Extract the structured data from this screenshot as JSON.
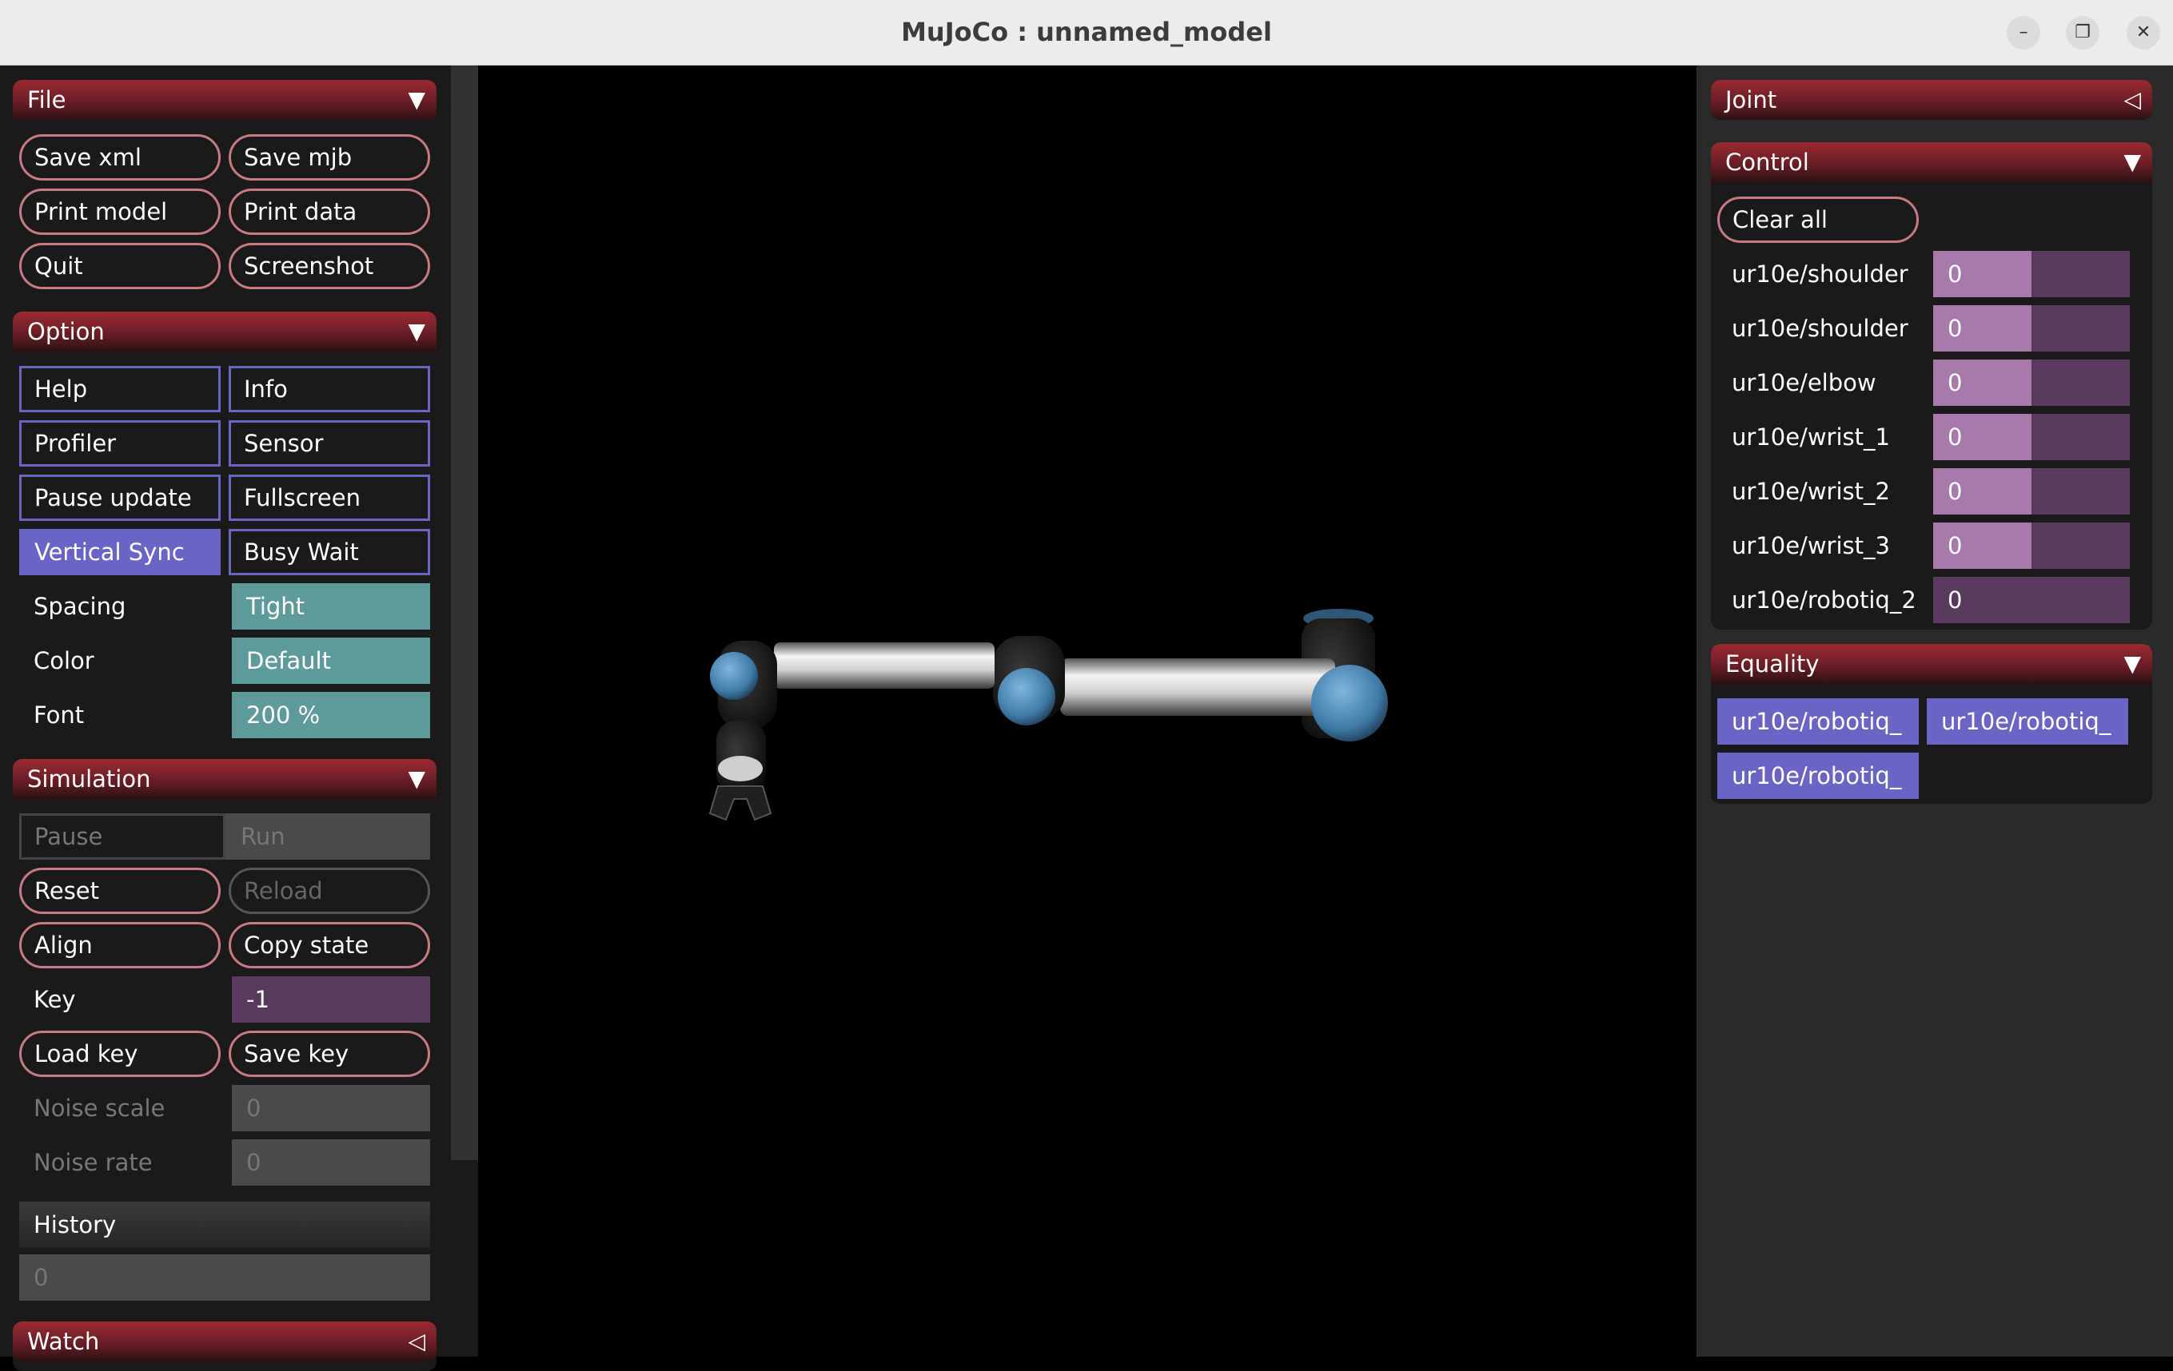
{
  "window": {
    "title": "MuJoCo : unnamed_model",
    "minimize_icon": "minimize-icon",
    "restore_icon": "restore-icon",
    "close_icon": "close-icon"
  },
  "file": {
    "title": "File",
    "buttons": [
      "Save xml",
      "Save mjb",
      "Print model",
      "Print data",
      "Quit",
      "Screenshot"
    ]
  },
  "option": {
    "title": "Option",
    "checks": [
      {
        "label": "Help",
        "checked": false
      },
      {
        "label": "Info",
        "checked": false
      },
      {
        "label": "Profiler",
        "checked": false
      },
      {
        "label": "Sensor",
        "checked": false
      },
      {
        "label": "Pause update",
        "checked": false
      },
      {
        "label": "Fullscreen",
        "checked": false
      },
      {
        "label": "Vertical Sync",
        "checked": true
      },
      {
        "label": "Busy Wait",
        "checked": false
      }
    ],
    "spacing_label": "Spacing",
    "spacing_value": "Tight",
    "color_label": "Color",
    "color_value": "Default",
    "font_label": "Font",
    "font_value": "200 %"
  },
  "simulation": {
    "title": "Simulation",
    "pause": "Pause",
    "run": "Run",
    "reset": "Reset",
    "reload": "Reload",
    "align": "Align",
    "copy_state": "Copy state",
    "key_label": "Key",
    "key_value": "-1",
    "load_key": "Load key",
    "save_key": "Save key",
    "noise_scale_label": "Noise scale",
    "noise_scale_value": "0",
    "noise_rate_label": "Noise rate",
    "noise_rate_value": "0",
    "history_label": "History",
    "history_value": "0"
  },
  "watch": {
    "title": "Watch"
  },
  "joint": {
    "title": "Joint"
  },
  "control": {
    "title": "Control",
    "clear_all": "Clear all",
    "rows": [
      {
        "label": "ur10e/shoulder",
        "value": "0",
        "fill": 0.5
      },
      {
        "label": "ur10e/shoulder",
        "value": "0",
        "fill": 0.5
      },
      {
        "label": "ur10e/elbow",
        "value": "0",
        "fill": 0.5
      },
      {
        "label": "ur10e/wrist_1",
        "value": "0",
        "fill": 0.5
      },
      {
        "label": "ur10e/wrist_2",
        "value": "0",
        "fill": 0.5
      },
      {
        "label": "ur10e/wrist_3",
        "value": "0",
        "fill": 0.5
      },
      {
        "label": "ur10e/robotiq_2",
        "value": "0",
        "fill": 0
      }
    ]
  },
  "equality": {
    "title": "Equality",
    "items": [
      "ur10e/robotiq_",
      "ur10e/robotiq_",
      "ur10e/robotiq_"
    ]
  },
  "colors": {
    "header_red": "#8a2530",
    "checkbox_blue": "#6a64c4",
    "select_teal": "#5f9a9a",
    "slider_purple": "#573a5c",
    "slider_fill": "#a87aac"
  }
}
